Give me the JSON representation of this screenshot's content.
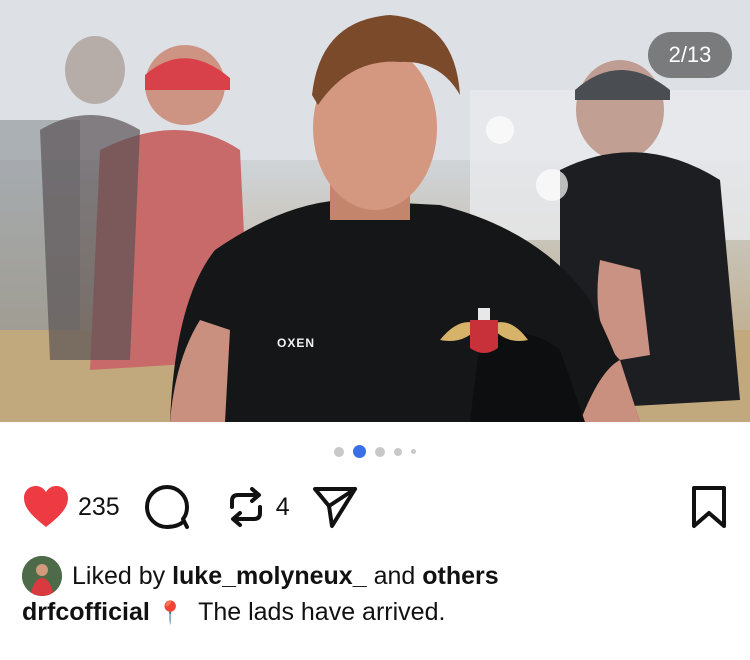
{
  "post": {
    "image_counter": "2/13",
    "carousel_active_index": 1,
    "shirt_brand": "OXEN"
  },
  "actions": {
    "like_count": "235",
    "repost_count": "4"
  },
  "likes": {
    "prefix": "Liked by",
    "user": "luke_molyneux_",
    "and": "and",
    "others": "others"
  },
  "caption": {
    "username": "drfcofficial",
    "emoji": "📍",
    "text": "The lads have arrived."
  },
  "colors": {
    "like_red": "#ed3a43",
    "active_dot": "#3b6fe6"
  }
}
